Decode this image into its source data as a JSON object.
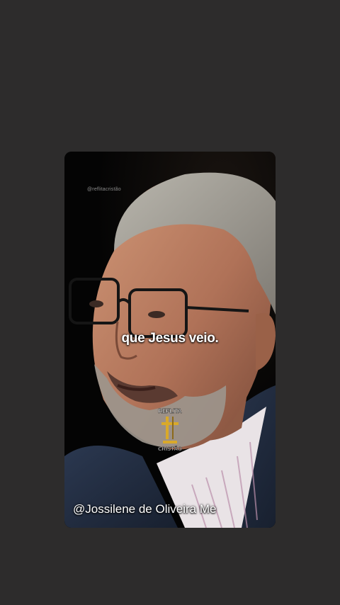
{
  "video": {
    "watermark_handle": "@reflitacristão",
    "caption": "que Jesus veio.",
    "logo_text_top": "REFLITA",
    "logo_text_bottom": "CRISTÃO",
    "credit_handle": "@Jossilene de Oliveira Me"
  },
  "colors": {
    "page_background": "#2d2c2c",
    "video_background": "#050505",
    "caption_text": "#ffffff",
    "logo_gold": "#d9a92a"
  }
}
